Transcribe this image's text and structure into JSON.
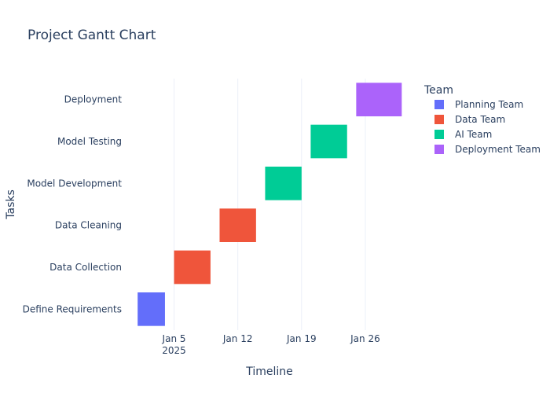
{
  "chart_data": {
    "type": "gantt",
    "title": "Project Gantt Chart",
    "xlabel": "Timeline",
    "ylabel": "Tasks",
    "x_range": [
      "2024-12-31T05:00",
      "2025-01-30T18:00"
    ],
    "x_ticks": [
      {
        "date": "2025-01-05",
        "label": "Jan 5",
        "sublabel": "2025"
      },
      {
        "date": "2025-01-12",
        "label": "Jan 12",
        "sublabel": ""
      },
      {
        "date": "2025-01-19",
        "label": "Jan 19",
        "sublabel": ""
      },
      {
        "date": "2025-01-26",
        "label": "Jan 26",
        "sublabel": ""
      }
    ],
    "categories": [
      "Define Requirements",
      "Data Collection",
      "Data Cleaning",
      "Model Development",
      "Model Testing",
      "Deployment"
    ],
    "tasks": [
      {
        "task": "Define Requirements",
        "start": "2025-01-01",
        "finish": "2025-01-04",
        "team": "Planning Team"
      },
      {
        "task": "Data Collection",
        "start": "2025-01-05",
        "finish": "2025-01-09",
        "team": "Data Team"
      },
      {
        "task": "Data Cleaning",
        "start": "2025-01-10",
        "finish": "2025-01-14",
        "team": "Data Team"
      },
      {
        "task": "Model Development",
        "start": "2025-01-15",
        "finish": "2025-01-19",
        "team": "AI Team"
      },
      {
        "task": "Model Testing",
        "start": "2025-01-20",
        "finish": "2025-01-24",
        "team": "AI Team"
      },
      {
        "task": "Deployment",
        "start": "2025-01-25",
        "finish": "2025-01-30",
        "team": "Deployment Team"
      }
    ],
    "legend": {
      "title": "Team",
      "placement": "top-right",
      "entries": [
        {
          "name": "Planning Team",
          "color": "#636efa"
        },
        {
          "name": "Data Team",
          "color": "#ef553b"
        },
        {
          "name": "AI Team",
          "color": "#00cc96"
        },
        {
          "name": "Deployment Team",
          "color": "#ab63fa"
        }
      ]
    },
    "grid": "vertical"
  }
}
